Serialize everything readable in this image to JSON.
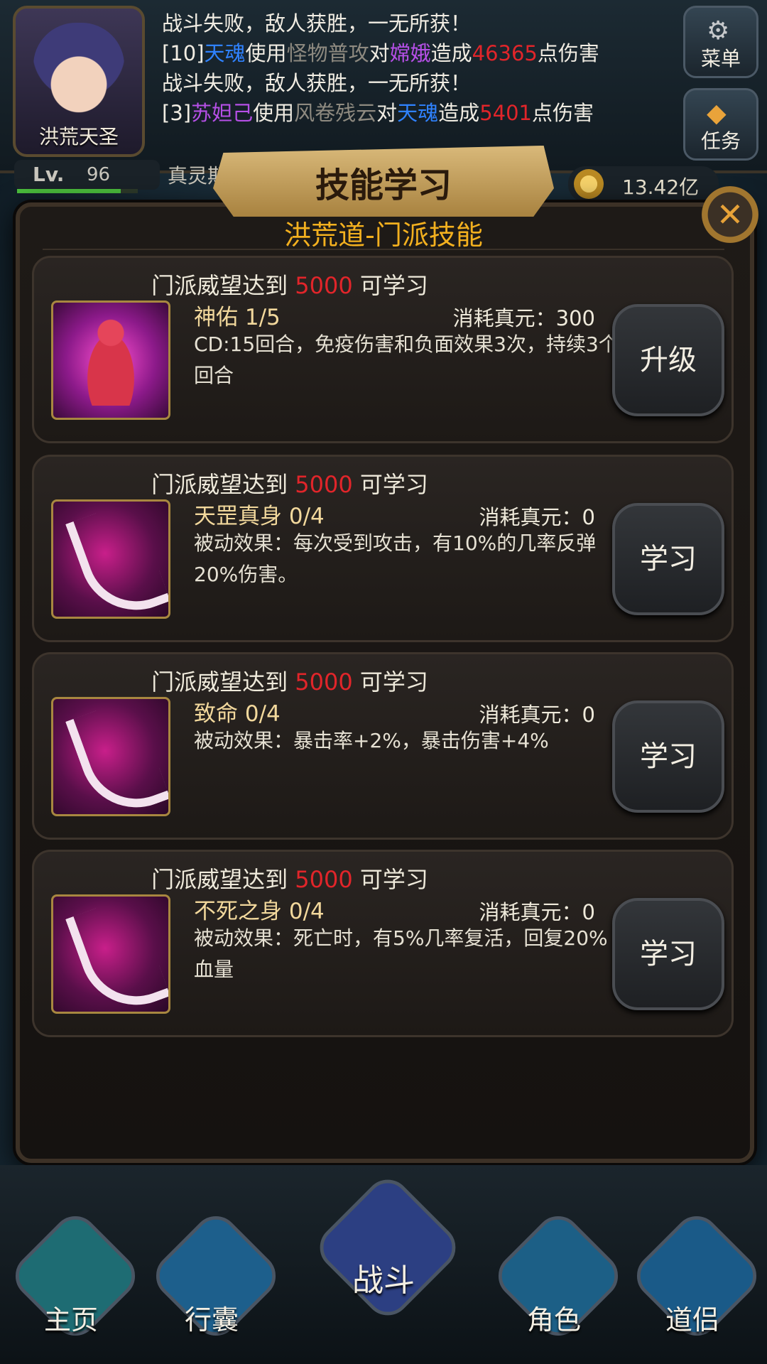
{
  "player": {
    "name": "洪荒天圣",
    "level_label": "Lv.",
    "level": "96",
    "realm": "真灵期",
    "exp_fraction": 0.86,
    "gold": "13.42亿"
  },
  "chat": [
    [
      {
        "t": "战斗失败，敌人获胜，一无所获！",
        "c": "white"
      }
    ],
    [
      {
        "t": "[10]",
        "c": "white"
      },
      {
        "t": "天魂",
        "c": "blue"
      },
      {
        "t": "使用",
        "c": "white"
      },
      {
        "t": "怪物普攻",
        "c": "grey"
      },
      {
        "t": "对",
        "c": "white"
      },
      {
        "t": "嫦娥",
        "c": "purple"
      },
      {
        "t": "造成",
        "c": "white"
      },
      {
        "t": "46365",
        "c": "red"
      },
      {
        "t": "点伤害",
        "c": "white"
      }
    ],
    [
      {
        "t": "战斗失败，敌人获胜，一无所获！",
        "c": "white"
      }
    ],
    [
      {
        "t": "[3]",
        "c": "white"
      },
      {
        "t": "苏妲己",
        "c": "purple"
      },
      {
        "t": "使用",
        "c": "white"
      },
      {
        "t": "风卷残云",
        "c": "grey"
      },
      {
        "t": "对",
        "c": "white"
      },
      {
        "t": "天魂",
        "c": "blue"
      },
      {
        "t": "造成",
        "c": "white"
      },
      {
        "t": "5401",
        "c": "red"
      },
      {
        "t": "点伤害",
        "c": "white"
      }
    ]
  ],
  "side_buttons": {
    "menu": "菜单",
    "quest": "任务"
  },
  "modal": {
    "title": "技能学习",
    "subtitle": "洪荒道-门派技能",
    "close_icon": "close-icon",
    "skills": [
      {
        "req_prefix": "门派威望达到",
        "req_value": "5000",
        "req_suffix": "可学习",
        "name": "神佑 1/5",
        "cost": "消耗真元：300",
        "desc": "CD:15回合，免疫伤害和负面效果3次，持续3个回合",
        "button": "升级",
        "icon": "meditating-monk-icon"
      },
      {
        "req_prefix": "门派威望达到",
        "req_value": "5000",
        "req_suffix": "可学习",
        "name": "天罡真身 0/4",
        "cost": "消耗真元：0",
        "desc": "被动效果：每次受到攻击，有10%的几率反弹20%伤害。",
        "button": "学习",
        "icon": "claw-slash-icon"
      },
      {
        "req_prefix": "门派威望达到",
        "req_value": "5000",
        "req_suffix": "可学习",
        "name": "致命 0/4",
        "cost": "消耗真元：0",
        "desc": "被动效果：暴击率+2%，暴击伤害+4%",
        "button": "学习",
        "icon": "claw-slash-icon"
      },
      {
        "req_prefix": "门派威望达到",
        "req_value": "5000",
        "req_suffix": "可学习",
        "name": "不死之身 0/4",
        "cost": "消耗真元：0",
        "desc": "被动效果：死亡时，有5%几率复活，回复20%血量",
        "button": "学习",
        "icon": "claw-slash-icon"
      }
    ]
  },
  "nav": [
    "主页",
    "行囊",
    "战斗",
    "角色",
    "道侣"
  ],
  "colors": {
    "accent": "#f3b01f",
    "highlight_red": "#e1252a"
  }
}
